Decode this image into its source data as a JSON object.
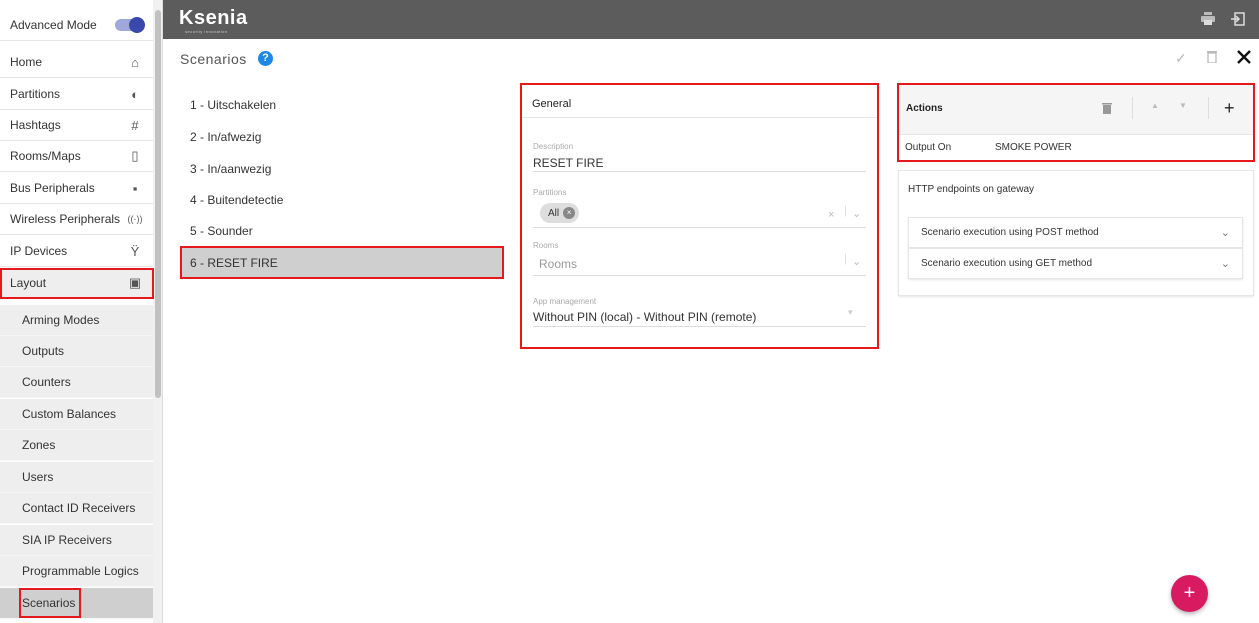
{
  "sidebar": {
    "mode_label": "Advanced Mode",
    "items": [
      {
        "label": "Home",
        "icon": "⌂"
      },
      {
        "label": "Partitions",
        "icon": "◐"
      },
      {
        "label": "Hashtags",
        "icon": "#"
      },
      {
        "label": "Rooms/Maps",
        "icon": "▯"
      },
      {
        "label": "Bus Peripherals",
        "icon": "▪"
      },
      {
        "label": "Wireless Peripherals",
        "icon": "((·))"
      },
      {
        "label": "IP Devices",
        "icon": "Ÿ"
      },
      {
        "label": "Layout",
        "icon": "▣"
      }
    ],
    "sub_items": [
      {
        "label": "Arming Modes"
      },
      {
        "label": "Outputs"
      },
      {
        "label": "Counters"
      },
      {
        "label": "Custom Balances"
      },
      {
        "label": "Zones"
      },
      {
        "label": "Users"
      },
      {
        "label": "Contact ID Receivers"
      },
      {
        "label": "SIA IP Receivers"
      },
      {
        "label": "Programmable Logics"
      },
      {
        "label": "Scenarios"
      }
    ]
  },
  "header": {
    "logo_text": "Ksenia",
    "logo_tagline": "security innovation"
  },
  "page": {
    "title": "Scenarios",
    "help": "?"
  },
  "scenarios": [
    {
      "label": "1 - Uitschakelen"
    },
    {
      "label": "2 - In/afwezig"
    },
    {
      "label": "3 - In/aanwezig"
    },
    {
      "label": "4 - Buitendetectie"
    },
    {
      "label": "5 - Sounder"
    },
    {
      "label": "6 - RESET FIRE"
    }
  ],
  "general": {
    "title": "General",
    "description_label": "Description",
    "description_value": "RESET FIRE",
    "partitions_label": "Partitions",
    "partitions_chip": "All",
    "rooms_label": "Rooms",
    "rooms_placeholder": "Rooms",
    "app_label": "App management",
    "app_value": "Without PIN (local) - Without PIN (remote)"
  },
  "actions": {
    "title": "Actions",
    "rows": [
      {
        "type": "Output On",
        "target": "SMOKE POWER"
      }
    ]
  },
  "http": {
    "title": "HTTP endpoints on gateway",
    "items": [
      {
        "label": "Scenario execution using POST method"
      },
      {
        "label": "Scenario execution using GET method"
      }
    ]
  },
  "fab": {
    "label": "+"
  },
  "colors": {
    "header_bg": "#5c5c5c",
    "highlight": "#e5191c",
    "fab": "#d81b60",
    "help": "#1e88e5",
    "toggle": "#3949ab"
  }
}
